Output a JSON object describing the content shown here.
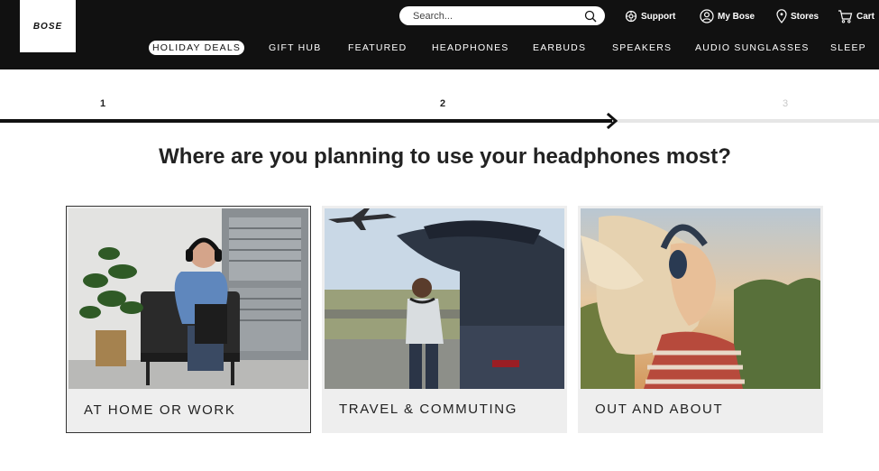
{
  "brand": {
    "logo_text": "BOSE"
  },
  "search": {
    "placeholder": "Search..."
  },
  "utility": {
    "support": "Support",
    "my_bose": "My Bose",
    "stores": "Stores",
    "cart": "Cart"
  },
  "nav": {
    "items": [
      "HOLIDAY DEALS",
      "GIFT HUB",
      "FEATURED",
      "HEADPHONES",
      "EARBUDS",
      "SPEAKERS",
      "AUDIO SUNGLASSES",
      "SLEEP"
    ]
  },
  "stepper": {
    "steps": [
      "1",
      "2",
      "3"
    ],
    "current_step": 2,
    "progress_fraction": 0.7
  },
  "quiz": {
    "question": "Where are you planning to use your headphones most?",
    "options": [
      {
        "label": "AT HOME OR WORK",
        "selected": true
      },
      {
        "label": "TRAVEL & COMMUTING",
        "selected": false
      },
      {
        "label": "OUT AND ABOUT",
        "selected": false
      }
    ]
  },
  "colors": {
    "header_bg": "#111111",
    "card_bg": "#eeeeee",
    "text": "#222222"
  }
}
